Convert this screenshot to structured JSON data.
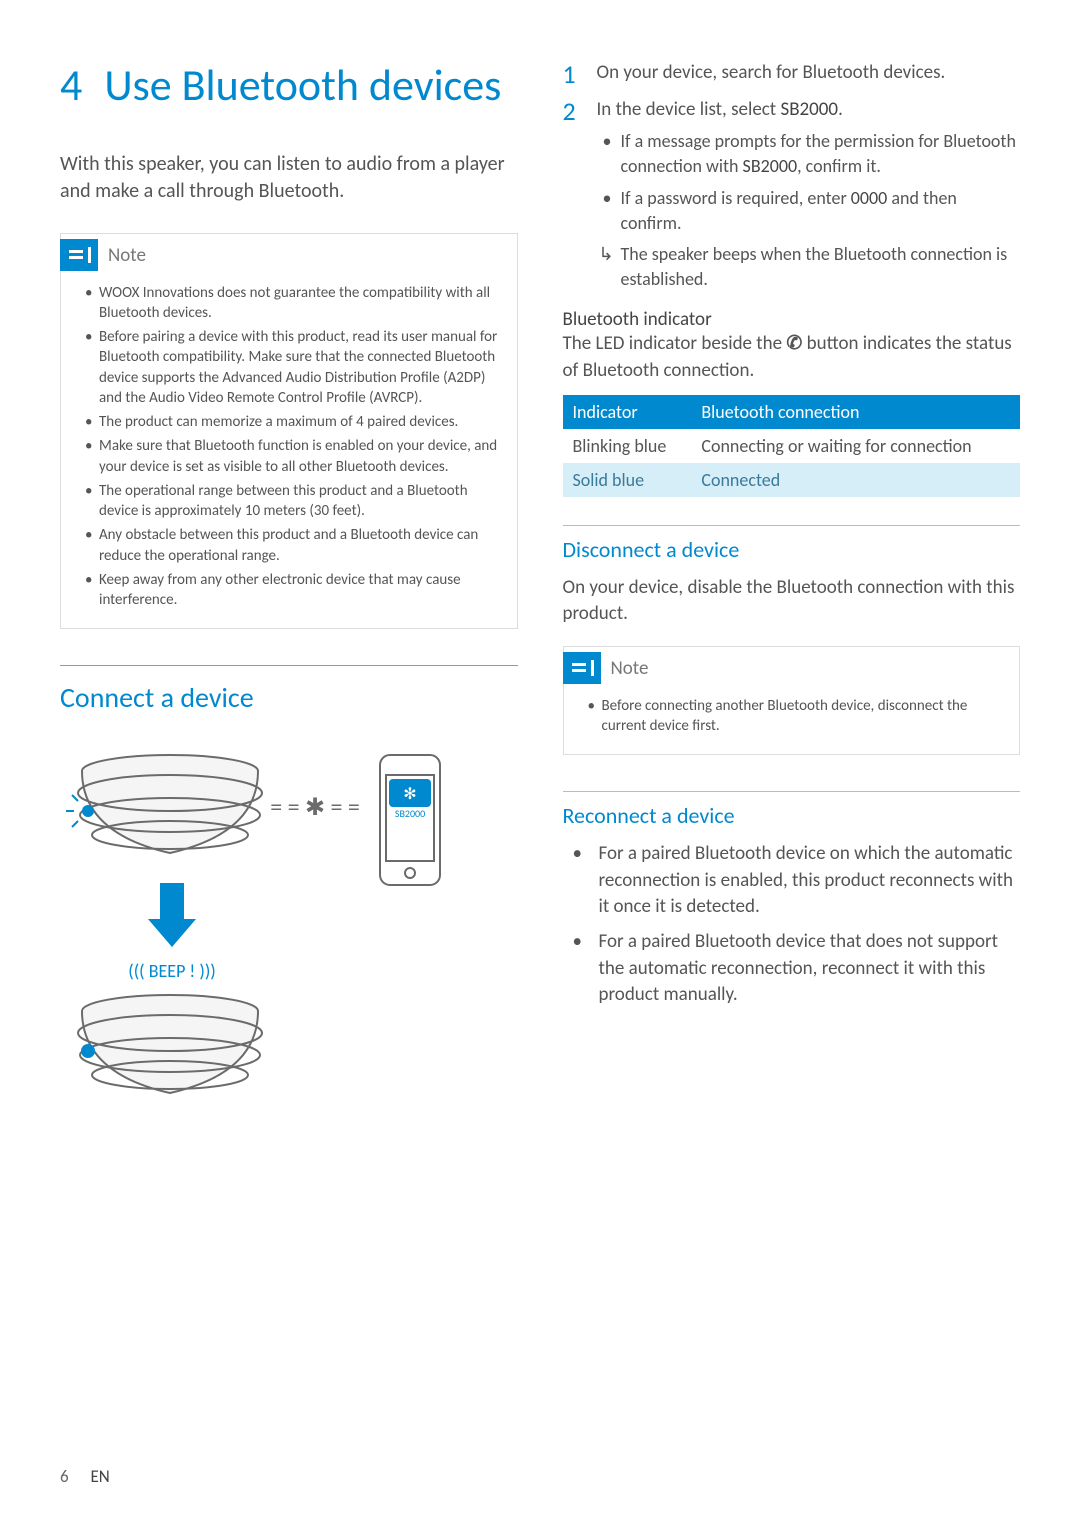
{
  "chapter": {
    "num": "4",
    "title": "Use Bluetooth devices"
  },
  "intro": "With this speaker, you can listen to audio from a player and make a call through Bluetooth.",
  "note1": {
    "label": "Note",
    "items": [
      "WOOX Innovations does not guarantee the compatibility with all Bluetooth devices.",
      "Before pairing a device with this product, read its user manual for Bluetooth compatibility. Make sure that the connected Bluetooth device supports the Advanced Audio Distribution Profile (A2DP) and the Audio Video Remote Control Profile (AVRCP).",
      "The product can memorize a maximum of 4 paired devices.",
      "Make sure that Bluetooth function is enabled on your device, and your device is set as visible to all other Bluetooth devices.",
      "The operational range between this product and a Bluetooth device is approximately 10 meters (30 feet).",
      "Any obstacle between this product and a Bluetooth device can reduce the operational range.",
      "Keep away from any other electronic device that may cause interference."
    ]
  },
  "connect": {
    "heading": "Connect a device"
  },
  "diagram": {
    "beep": "BEEP !",
    "phone_label": "SB2000"
  },
  "steps": [
    {
      "num": "1",
      "text": "On your device, search for Bluetooth devices."
    },
    {
      "num": "2",
      "text_pre": "In the device list, select ",
      "text_bold": "SB2000",
      "text_post": ".",
      "subs": [
        {
          "type": "bul",
          "pre": "If a message prompts for the permission for Bluetooth connection with ",
          "bold": "SB2000",
          "post": ", confirm it."
        },
        {
          "type": "bul",
          "pre": "If a password is required, enter ",
          "bold": "0000",
          "post": " and then confirm."
        },
        {
          "type": "arr",
          "text": "The speaker beeps when the Bluetooth connection is established."
        }
      ]
    }
  ],
  "bt_indicator": {
    "heading": "Bluetooth indicator",
    "desc_pre": "The LED indicator beside the ",
    "desc_post": " button indicates the status of Bluetooth connection.",
    "icon": "✆",
    "table": {
      "h1": "Indicator",
      "h2": "Bluetooth connection",
      "rows": [
        {
          "c1": "Blinking blue",
          "c2": "Connecting or waiting for connection",
          "alt": false
        },
        {
          "c1": "Solid blue",
          "c2": "Connected",
          "alt": true
        }
      ]
    }
  },
  "disconnect": {
    "heading": "Disconnect a device",
    "text": "On your device, disable the Bluetooth connection with this product."
  },
  "note2": {
    "label": "Note",
    "items": [
      "Before connecting another Bluetooth device, disconnect the current device first."
    ]
  },
  "reconnect": {
    "heading": "Reconnect a device",
    "items": [
      "For a paired Bluetooth device on which the automatic reconnection is enabled, this product reconnects with it once it is detected.",
      "For a paired Bluetooth device that does not support the automatic reconnection, reconnect it with this product manually."
    ]
  },
  "footer": {
    "page": "6",
    "lang": "EN"
  }
}
